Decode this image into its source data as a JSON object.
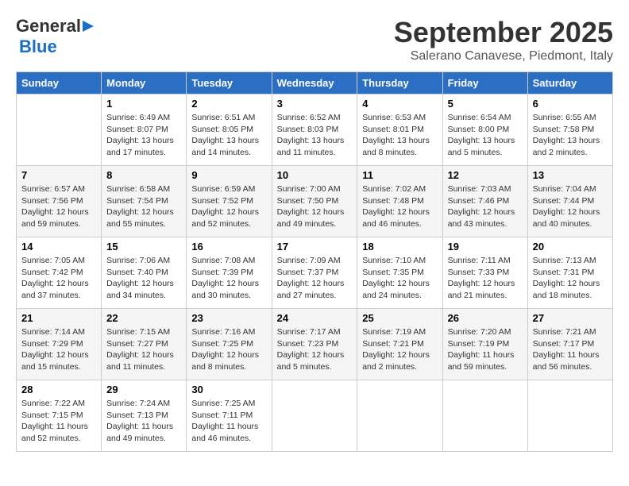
{
  "logo": {
    "general": "General",
    "blue": "Blue"
  },
  "title": "September 2025",
  "subtitle": "Salerano Canavese, Piedmont, Italy",
  "headers": [
    "Sunday",
    "Monday",
    "Tuesday",
    "Wednesday",
    "Thursday",
    "Friday",
    "Saturday"
  ],
  "weeks": [
    [
      {
        "day": "",
        "info": ""
      },
      {
        "day": "1",
        "info": "Sunrise: 6:49 AM\nSunset: 8:07 PM\nDaylight: 13 hours\nand 17 minutes."
      },
      {
        "day": "2",
        "info": "Sunrise: 6:51 AM\nSunset: 8:05 PM\nDaylight: 13 hours\nand 14 minutes."
      },
      {
        "day": "3",
        "info": "Sunrise: 6:52 AM\nSunset: 8:03 PM\nDaylight: 13 hours\nand 11 minutes."
      },
      {
        "day": "4",
        "info": "Sunrise: 6:53 AM\nSunset: 8:01 PM\nDaylight: 13 hours\nand 8 minutes."
      },
      {
        "day": "5",
        "info": "Sunrise: 6:54 AM\nSunset: 8:00 PM\nDaylight: 13 hours\nand 5 minutes."
      },
      {
        "day": "6",
        "info": "Sunrise: 6:55 AM\nSunset: 7:58 PM\nDaylight: 13 hours\nand 2 minutes."
      }
    ],
    [
      {
        "day": "7",
        "info": "Sunrise: 6:57 AM\nSunset: 7:56 PM\nDaylight: 12 hours\nand 59 minutes."
      },
      {
        "day": "8",
        "info": "Sunrise: 6:58 AM\nSunset: 7:54 PM\nDaylight: 12 hours\nand 55 minutes."
      },
      {
        "day": "9",
        "info": "Sunrise: 6:59 AM\nSunset: 7:52 PM\nDaylight: 12 hours\nand 52 minutes."
      },
      {
        "day": "10",
        "info": "Sunrise: 7:00 AM\nSunset: 7:50 PM\nDaylight: 12 hours\nand 49 minutes."
      },
      {
        "day": "11",
        "info": "Sunrise: 7:02 AM\nSunset: 7:48 PM\nDaylight: 12 hours\nand 46 minutes."
      },
      {
        "day": "12",
        "info": "Sunrise: 7:03 AM\nSunset: 7:46 PM\nDaylight: 12 hours\nand 43 minutes."
      },
      {
        "day": "13",
        "info": "Sunrise: 7:04 AM\nSunset: 7:44 PM\nDaylight: 12 hours\nand 40 minutes."
      }
    ],
    [
      {
        "day": "14",
        "info": "Sunrise: 7:05 AM\nSunset: 7:42 PM\nDaylight: 12 hours\nand 37 minutes."
      },
      {
        "day": "15",
        "info": "Sunrise: 7:06 AM\nSunset: 7:40 PM\nDaylight: 12 hours\nand 34 minutes."
      },
      {
        "day": "16",
        "info": "Sunrise: 7:08 AM\nSunset: 7:39 PM\nDaylight: 12 hours\nand 30 minutes."
      },
      {
        "day": "17",
        "info": "Sunrise: 7:09 AM\nSunset: 7:37 PM\nDaylight: 12 hours\nand 27 minutes."
      },
      {
        "day": "18",
        "info": "Sunrise: 7:10 AM\nSunset: 7:35 PM\nDaylight: 12 hours\nand 24 minutes."
      },
      {
        "day": "19",
        "info": "Sunrise: 7:11 AM\nSunset: 7:33 PM\nDaylight: 12 hours\nand 21 minutes."
      },
      {
        "day": "20",
        "info": "Sunrise: 7:13 AM\nSunset: 7:31 PM\nDaylight: 12 hours\nand 18 minutes."
      }
    ],
    [
      {
        "day": "21",
        "info": "Sunrise: 7:14 AM\nSunset: 7:29 PM\nDaylight: 12 hours\nand 15 minutes."
      },
      {
        "day": "22",
        "info": "Sunrise: 7:15 AM\nSunset: 7:27 PM\nDaylight: 12 hours\nand 11 minutes."
      },
      {
        "day": "23",
        "info": "Sunrise: 7:16 AM\nSunset: 7:25 PM\nDaylight: 12 hours\nand 8 minutes."
      },
      {
        "day": "24",
        "info": "Sunrise: 7:17 AM\nSunset: 7:23 PM\nDaylight: 12 hours\nand 5 minutes."
      },
      {
        "day": "25",
        "info": "Sunrise: 7:19 AM\nSunset: 7:21 PM\nDaylight: 12 hours\nand 2 minutes."
      },
      {
        "day": "26",
        "info": "Sunrise: 7:20 AM\nSunset: 7:19 PM\nDaylight: 11 hours\nand 59 minutes."
      },
      {
        "day": "27",
        "info": "Sunrise: 7:21 AM\nSunset: 7:17 PM\nDaylight: 11 hours\nand 56 minutes."
      }
    ],
    [
      {
        "day": "28",
        "info": "Sunrise: 7:22 AM\nSunset: 7:15 PM\nDaylight: 11 hours\nand 52 minutes."
      },
      {
        "day": "29",
        "info": "Sunrise: 7:24 AM\nSunset: 7:13 PM\nDaylight: 11 hours\nand 49 minutes."
      },
      {
        "day": "30",
        "info": "Sunrise: 7:25 AM\nSunset: 7:11 PM\nDaylight: 11 hours\nand 46 minutes."
      },
      {
        "day": "",
        "info": ""
      },
      {
        "day": "",
        "info": ""
      },
      {
        "day": "",
        "info": ""
      },
      {
        "day": "",
        "info": ""
      }
    ]
  ]
}
